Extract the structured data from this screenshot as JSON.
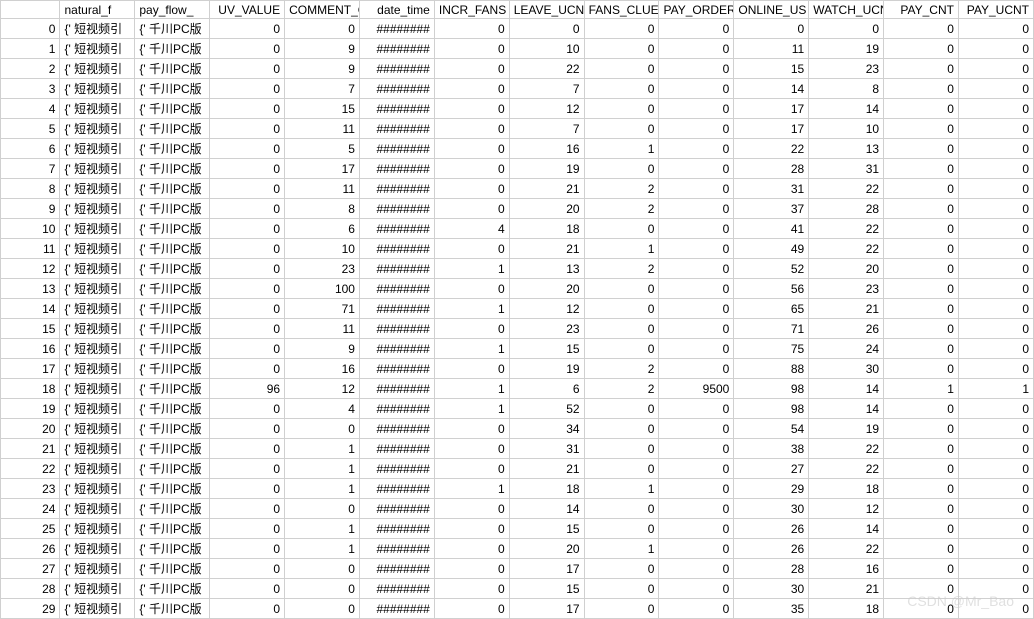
{
  "watermark": "CSDN @Mr_Bao",
  "columns": [
    {
      "key": "rownum",
      "label": "",
      "class": "col-rownum"
    },
    {
      "key": "natural_f",
      "label": "natural_f",
      "class": "col-natural"
    },
    {
      "key": "pay_flow",
      "label": "pay_flow_",
      "class": "col-payflow"
    },
    {
      "key": "uv_value",
      "label": "UV_VALUE",
      "class": "col-uvvalue"
    },
    {
      "key": "comment_c",
      "label": "COMMENT_C",
      "class": "col-comment"
    },
    {
      "key": "date_time",
      "label": "date_time",
      "class": "col-datetime"
    },
    {
      "key": "incr_fans",
      "label": "INCR_FANS",
      "class": "col-incrfans"
    },
    {
      "key": "leave_ucn",
      "label": "LEAVE_UCN",
      "class": "col-leaveucn"
    },
    {
      "key": "fans_clue",
      "label": "FANS_CLUE",
      "class": "col-fansclue"
    },
    {
      "key": "pay_order",
      "label": "PAY_ORDER",
      "class": "col-payorder"
    },
    {
      "key": "online_us",
      "label": "ONLINE_US",
      "class": "col-onlineus"
    },
    {
      "key": "watch_ucn",
      "label": "WATCH_UCN",
      "class": "col-watchucn"
    },
    {
      "key": "pay_cnt",
      "label": "PAY_CNT",
      "class": "col-paycnt"
    },
    {
      "key": "pay_ucnt",
      "label": "PAY_UCNT",
      "class": "col-payucnt"
    }
  ],
  "rows": [
    {
      "rownum": "0",
      "natural_f": "{' 短视频引",
      "pay_flow": "{' 千川PC版",
      "uv_value": "0",
      "comment_c": "0",
      "date_time": "########",
      "incr_fans": "0",
      "leave_ucn": "0",
      "fans_clue": "0",
      "pay_order": "0",
      "online_us": "0",
      "watch_ucn": "0",
      "pay_cnt": "0",
      "pay_ucnt": "0"
    },
    {
      "rownum": "1",
      "natural_f": "{' 短视频引",
      "pay_flow": "{' 千川PC版",
      "uv_value": "0",
      "comment_c": "9",
      "date_time": "########",
      "incr_fans": "0",
      "leave_ucn": "10",
      "fans_clue": "0",
      "pay_order": "0",
      "online_us": "11",
      "watch_ucn": "19",
      "pay_cnt": "0",
      "pay_ucnt": "0"
    },
    {
      "rownum": "2",
      "natural_f": "{' 短视频引",
      "pay_flow": "{' 千川PC版",
      "uv_value": "0",
      "comment_c": "9",
      "date_time": "########",
      "incr_fans": "0",
      "leave_ucn": "22",
      "fans_clue": "0",
      "pay_order": "0",
      "online_us": "15",
      "watch_ucn": "23",
      "pay_cnt": "0",
      "pay_ucnt": "0"
    },
    {
      "rownum": "3",
      "natural_f": "{' 短视频引",
      "pay_flow": "{' 千川PC版",
      "uv_value": "0",
      "comment_c": "7",
      "date_time": "########",
      "incr_fans": "0",
      "leave_ucn": "7",
      "fans_clue": "0",
      "pay_order": "0",
      "online_us": "14",
      "watch_ucn": "8",
      "pay_cnt": "0",
      "pay_ucnt": "0"
    },
    {
      "rownum": "4",
      "natural_f": "{' 短视频引",
      "pay_flow": "{' 千川PC版",
      "uv_value": "0",
      "comment_c": "15",
      "date_time": "########",
      "incr_fans": "0",
      "leave_ucn": "12",
      "fans_clue": "0",
      "pay_order": "0",
      "online_us": "17",
      "watch_ucn": "14",
      "pay_cnt": "0",
      "pay_ucnt": "0"
    },
    {
      "rownum": "5",
      "natural_f": "{' 短视频引",
      "pay_flow": "{' 千川PC版",
      "uv_value": "0",
      "comment_c": "11",
      "date_time": "########",
      "incr_fans": "0",
      "leave_ucn": "7",
      "fans_clue": "0",
      "pay_order": "0",
      "online_us": "17",
      "watch_ucn": "10",
      "pay_cnt": "0",
      "pay_ucnt": "0"
    },
    {
      "rownum": "6",
      "natural_f": "{' 短视频引",
      "pay_flow": "{' 千川PC版",
      "uv_value": "0",
      "comment_c": "5",
      "date_time": "########",
      "incr_fans": "0",
      "leave_ucn": "16",
      "fans_clue": "1",
      "pay_order": "0",
      "online_us": "22",
      "watch_ucn": "13",
      "pay_cnt": "0",
      "pay_ucnt": "0"
    },
    {
      "rownum": "7",
      "natural_f": "{' 短视频引",
      "pay_flow": "{' 千川PC版",
      "uv_value": "0",
      "comment_c": "17",
      "date_time": "########",
      "incr_fans": "0",
      "leave_ucn": "19",
      "fans_clue": "0",
      "pay_order": "0",
      "online_us": "28",
      "watch_ucn": "31",
      "pay_cnt": "0",
      "pay_ucnt": "0"
    },
    {
      "rownum": "8",
      "natural_f": "{' 短视频引",
      "pay_flow": "{' 千川PC版",
      "uv_value": "0",
      "comment_c": "11",
      "date_time": "########",
      "incr_fans": "0",
      "leave_ucn": "21",
      "fans_clue": "2",
      "pay_order": "0",
      "online_us": "31",
      "watch_ucn": "22",
      "pay_cnt": "0",
      "pay_ucnt": "0"
    },
    {
      "rownum": "9",
      "natural_f": "{' 短视频引",
      "pay_flow": "{' 千川PC版",
      "uv_value": "0",
      "comment_c": "8",
      "date_time": "########",
      "incr_fans": "0",
      "leave_ucn": "20",
      "fans_clue": "2",
      "pay_order": "0",
      "online_us": "37",
      "watch_ucn": "28",
      "pay_cnt": "0",
      "pay_ucnt": "0"
    },
    {
      "rownum": "10",
      "natural_f": "{' 短视频引",
      "pay_flow": "{' 千川PC版",
      "uv_value": "0",
      "comment_c": "6",
      "date_time": "########",
      "incr_fans": "4",
      "leave_ucn": "18",
      "fans_clue": "0",
      "pay_order": "0",
      "online_us": "41",
      "watch_ucn": "22",
      "pay_cnt": "0",
      "pay_ucnt": "0"
    },
    {
      "rownum": "11",
      "natural_f": "{' 短视频引",
      "pay_flow": "{' 千川PC版",
      "uv_value": "0",
      "comment_c": "10",
      "date_time": "########",
      "incr_fans": "0",
      "leave_ucn": "21",
      "fans_clue": "1",
      "pay_order": "0",
      "online_us": "49",
      "watch_ucn": "22",
      "pay_cnt": "0",
      "pay_ucnt": "0"
    },
    {
      "rownum": "12",
      "natural_f": "{' 短视频引",
      "pay_flow": "{' 千川PC版",
      "uv_value": "0",
      "comment_c": "23",
      "date_time": "########",
      "incr_fans": "1",
      "leave_ucn": "13",
      "fans_clue": "2",
      "pay_order": "0",
      "online_us": "52",
      "watch_ucn": "20",
      "pay_cnt": "0",
      "pay_ucnt": "0"
    },
    {
      "rownum": "13",
      "natural_f": "{' 短视频引",
      "pay_flow": "{' 千川PC版",
      "uv_value": "0",
      "comment_c": "100",
      "date_time": "########",
      "incr_fans": "0",
      "leave_ucn": "20",
      "fans_clue": "0",
      "pay_order": "0",
      "online_us": "56",
      "watch_ucn": "23",
      "pay_cnt": "0",
      "pay_ucnt": "0"
    },
    {
      "rownum": "14",
      "natural_f": "{' 短视频引",
      "pay_flow": "{' 千川PC版",
      "uv_value": "0",
      "comment_c": "71",
      "date_time": "########",
      "incr_fans": "1",
      "leave_ucn": "12",
      "fans_clue": "0",
      "pay_order": "0",
      "online_us": "65",
      "watch_ucn": "21",
      "pay_cnt": "0",
      "pay_ucnt": "0"
    },
    {
      "rownum": "15",
      "natural_f": "{' 短视频引",
      "pay_flow": "{' 千川PC版",
      "uv_value": "0",
      "comment_c": "11",
      "date_time": "########",
      "incr_fans": "0",
      "leave_ucn": "23",
      "fans_clue": "0",
      "pay_order": "0",
      "online_us": "71",
      "watch_ucn": "26",
      "pay_cnt": "0",
      "pay_ucnt": "0"
    },
    {
      "rownum": "16",
      "natural_f": "{' 短视频引",
      "pay_flow": "{' 千川PC版",
      "uv_value": "0",
      "comment_c": "9",
      "date_time": "########",
      "incr_fans": "1",
      "leave_ucn": "15",
      "fans_clue": "0",
      "pay_order": "0",
      "online_us": "75",
      "watch_ucn": "24",
      "pay_cnt": "0",
      "pay_ucnt": "0"
    },
    {
      "rownum": "17",
      "natural_f": "{' 短视频引",
      "pay_flow": "{' 千川PC版",
      "uv_value": "0",
      "comment_c": "16",
      "date_time": "########",
      "incr_fans": "0",
      "leave_ucn": "19",
      "fans_clue": "2",
      "pay_order": "0",
      "online_us": "88",
      "watch_ucn": "30",
      "pay_cnt": "0",
      "pay_ucnt": "0"
    },
    {
      "rownum": "18",
      "natural_f": "{' 短视频引",
      "pay_flow": "{' 千川PC版",
      "uv_value": "96",
      "comment_c": "12",
      "date_time": "########",
      "incr_fans": "1",
      "leave_ucn": "6",
      "fans_clue": "2",
      "pay_order": "9500",
      "online_us": "98",
      "watch_ucn": "14",
      "pay_cnt": "1",
      "pay_ucnt": "1"
    },
    {
      "rownum": "19",
      "natural_f": "{' 短视频引",
      "pay_flow": "{' 千川PC版",
      "uv_value": "0",
      "comment_c": "4",
      "date_time": "########",
      "incr_fans": "1",
      "leave_ucn": "52",
      "fans_clue": "0",
      "pay_order": "0",
      "online_us": "98",
      "watch_ucn": "14",
      "pay_cnt": "0",
      "pay_ucnt": "0"
    },
    {
      "rownum": "20",
      "natural_f": "{' 短视频引",
      "pay_flow": "{' 千川PC版",
      "uv_value": "0",
      "comment_c": "0",
      "date_time": "########",
      "incr_fans": "0",
      "leave_ucn": "34",
      "fans_clue": "0",
      "pay_order": "0",
      "online_us": "54",
      "watch_ucn": "19",
      "pay_cnt": "0",
      "pay_ucnt": "0"
    },
    {
      "rownum": "21",
      "natural_f": "{' 短视频引",
      "pay_flow": "{' 千川PC版",
      "uv_value": "0",
      "comment_c": "1",
      "date_time": "########",
      "incr_fans": "0",
      "leave_ucn": "31",
      "fans_clue": "0",
      "pay_order": "0",
      "online_us": "38",
      "watch_ucn": "22",
      "pay_cnt": "0",
      "pay_ucnt": "0"
    },
    {
      "rownum": "22",
      "natural_f": "{' 短视频引",
      "pay_flow": "{' 千川PC版",
      "uv_value": "0",
      "comment_c": "1",
      "date_time": "########",
      "incr_fans": "0",
      "leave_ucn": "21",
      "fans_clue": "0",
      "pay_order": "0",
      "online_us": "27",
      "watch_ucn": "22",
      "pay_cnt": "0",
      "pay_ucnt": "0"
    },
    {
      "rownum": "23",
      "natural_f": "{' 短视频引",
      "pay_flow": "{' 千川PC版",
      "uv_value": "0",
      "comment_c": "1",
      "date_time": "########",
      "incr_fans": "1",
      "leave_ucn": "18",
      "fans_clue": "1",
      "pay_order": "0",
      "online_us": "29",
      "watch_ucn": "18",
      "pay_cnt": "0",
      "pay_ucnt": "0"
    },
    {
      "rownum": "24",
      "natural_f": "{' 短视频引",
      "pay_flow": "{' 千川PC版",
      "uv_value": "0",
      "comment_c": "0",
      "date_time": "########",
      "incr_fans": "0",
      "leave_ucn": "14",
      "fans_clue": "0",
      "pay_order": "0",
      "online_us": "30",
      "watch_ucn": "12",
      "pay_cnt": "0",
      "pay_ucnt": "0"
    },
    {
      "rownum": "25",
      "natural_f": "{' 短视频引",
      "pay_flow": "{' 千川PC版",
      "uv_value": "0",
      "comment_c": "1",
      "date_time": "########",
      "incr_fans": "0",
      "leave_ucn": "15",
      "fans_clue": "0",
      "pay_order": "0",
      "online_us": "26",
      "watch_ucn": "14",
      "pay_cnt": "0",
      "pay_ucnt": "0"
    },
    {
      "rownum": "26",
      "natural_f": "{' 短视频引",
      "pay_flow": "{' 千川PC版",
      "uv_value": "0",
      "comment_c": "1",
      "date_time": "########",
      "incr_fans": "0",
      "leave_ucn": "20",
      "fans_clue": "1",
      "pay_order": "0",
      "online_us": "26",
      "watch_ucn": "22",
      "pay_cnt": "0",
      "pay_ucnt": "0"
    },
    {
      "rownum": "27",
      "natural_f": "{' 短视频引",
      "pay_flow": "{' 千川PC版",
      "uv_value": "0",
      "comment_c": "0",
      "date_time": "########",
      "incr_fans": "0",
      "leave_ucn": "17",
      "fans_clue": "0",
      "pay_order": "0",
      "online_us": "28",
      "watch_ucn": "16",
      "pay_cnt": "0",
      "pay_ucnt": "0"
    },
    {
      "rownum": "28",
      "natural_f": "{' 短视频引",
      "pay_flow": "{' 千川PC版",
      "uv_value": "0",
      "comment_c": "0",
      "date_time": "########",
      "incr_fans": "0",
      "leave_ucn": "15",
      "fans_clue": "0",
      "pay_order": "0",
      "online_us": "30",
      "watch_ucn": "21",
      "pay_cnt": "0",
      "pay_ucnt": "0"
    },
    {
      "rownum": "29",
      "natural_f": "{' 短视频引",
      "pay_flow": "{' 千川PC版",
      "uv_value": "0",
      "comment_c": "0",
      "date_time": "########",
      "incr_fans": "0",
      "leave_ucn": "17",
      "fans_clue": "0",
      "pay_order": "0",
      "online_us": "35",
      "watch_ucn": "18",
      "pay_cnt": "0",
      "pay_ucnt": "0"
    }
  ]
}
